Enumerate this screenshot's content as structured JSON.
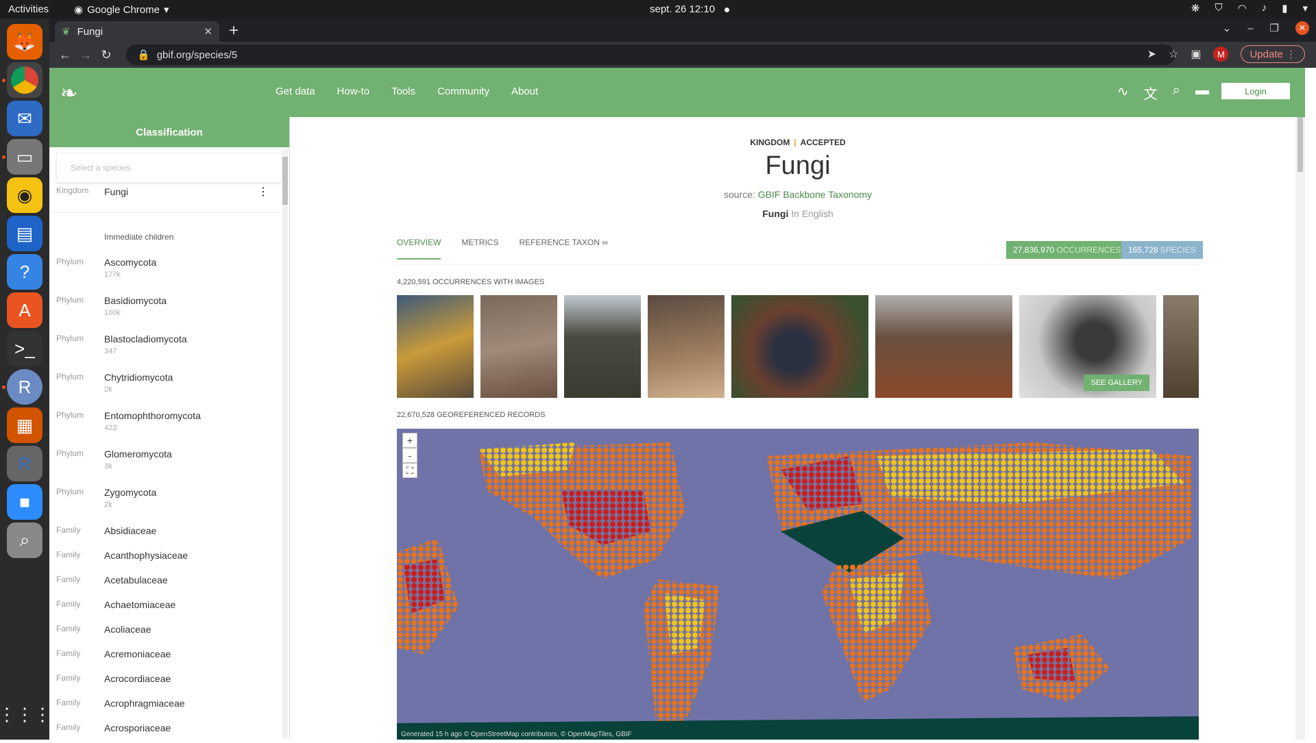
{
  "os": {
    "activities": "Activities",
    "app_name": "Google Chrome",
    "clock": "sept. 26  12:10"
  },
  "browser": {
    "tab_title": "Fungi",
    "url": "gbif.org/species/5",
    "update_label": "Update",
    "avatar_letter": "M"
  },
  "gbif": {
    "nav": [
      "Get data",
      "How-to",
      "Tools",
      "Community",
      "About"
    ],
    "login": "Login",
    "accent": "#71b171"
  },
  "sidebar": {
    "title": "Classification",
    "search_placeholder": "Select a species",
    "current": {
      "rank": "Kingdom",
      "name": "Fungi"
    },
    "children_label": "Immediate children",
    "children": [
      {
        "rank": "Phylum",
        "name": "Ascomycota",
        "count": "177k"
      },
      {
        "rank": "Phylum",
        "name": "Basidiomycota",
        "count": "100k"
      },
      {
        "rank": "Phylum",
        "name": "Blastocladiomycota",
        "count": "347"
      },
      {
        "rank": "Phylum",
        "name": "Chytridiomycota",
        "count": "2k"
      },
      {
        "rank": "Phylum",
        "name": "Entomophthoromycota",
        "count": "423"
      },
      {
        "rank": "Phylum",
        "name": "Glomeromycota",
        "count": "3k"
      },
      {
        "rank": "Phylum",
        "name": "Zygomycota",
        "count": "2k"
      }
    ],
    "families": [
      {
        "rank": "Family",
        "name": "Absidiaceae"
      },
      {
        "rank": "Family",
        "name": "Acanthophysiaceae"
      },
      {
        "rank": "Family",
        "name": "Acetabulaceae"
      },
      {
        "rank": "Family",
        "name": "Achaetomiaceae"
      },
      {
        "rank": "Family",
        "name": "Acoliaceae"
      },
      {
        "rank": "Family",
        "name": "Acremoniaceae"
      },
      {
        "rank": "Family",
        "name": "Acrocordiaceae"
      },
      {
        "rank": "Family",
        "name": "Acrophragmiaceae"
      },
      {
        "rank": "Family",
        "name": "Acrosporiaceae"
      }
    ]
  },
  "main": {
    "rank": "KINGDOM",
    "status": "ACCEPTED",
    "title": "Fungi",
    "source_prefix": "source:",
    "source_link": "GBIF Backbone Taxonomy",
    "vernacular_name": "Fungi",
    "vernacular_lang": " In English",
    "tabs": [
      "OVERVIEW",
      "METRICS",
      "REFERENCE TAXON ∞"
    ],
    "occurrences_count": "27,836,970",
    "occurrences_label": "OCCURRENCES",
    "species_count": "165,728",
    "species_label": "SPECIES",
    "images_label": "4,220,591 OCCURRENCES WITH IMAGES",
    "see_gallery": "SEE GALLERY",
    "geo_label": "22,670,528 GEOREFERENCED RECORDS",
    "map_attribution": "Generated 15 h ago © OpenStreetMap contributors, © OpenMapTiles, GBIF"
  }
}
